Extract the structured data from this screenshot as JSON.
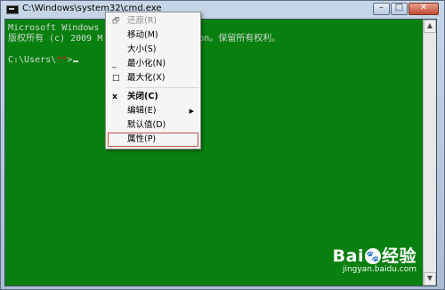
{
  "window": {
    "title": "C:\\Windows\\system32\\cmd.exe"
  },
  "caption_buttons": {
    "minimize_glyph": "–",
    "maximize_glyph": "□",
    "close_glyph": "✕"
  },
  "console": {
    "line1": "Microsoft Windows [",
    "line1_tail": "",
    "line2": "版权所有 (c) 2009 M",
    "line2_tail": "on。保留所有权利。",
    "prompt_prefix": "C:\\Users\\",
    "prompt_user": "**",
    "prompt_suffix": ">"
  },
  "context_menu": {
    "items": [
      {
        "label": "还原(R)",
        "glyph": "🗗"
      },
      {
        "label": "移动(M)",
        "glyph": ""
      },
      {
        "label": "大小(S)",
        "glyph": ""
      },
      {
        "label": "最小化(N)",
        "glyph": "_"
      },
      {
        "label": "最大化(X)",
        "glyph": "□"
      },
      {
        "label": "关闭(C)",
        "glyph": "x"
      },
      {
        "label": "编辑(E)",
        "glyph": ""
      },
      {
        "label": "默认值(D)",
        "glyph": ""
      },
      {
        "label": "属性(P)",
        "glyph": ""
      }
    ],
    "submenu_arrow": "▶"
  },
  "watermark": {
    "logo_left": "Bai",
    "logo_paw": "🐾",
    "logo_right": "经验",
    "url": "jingyan.baidu.com"
  },
  "colors": {
    "console_background": "#08800f",
    "menu_highlight_outline": "#c0504d"
  }
}
